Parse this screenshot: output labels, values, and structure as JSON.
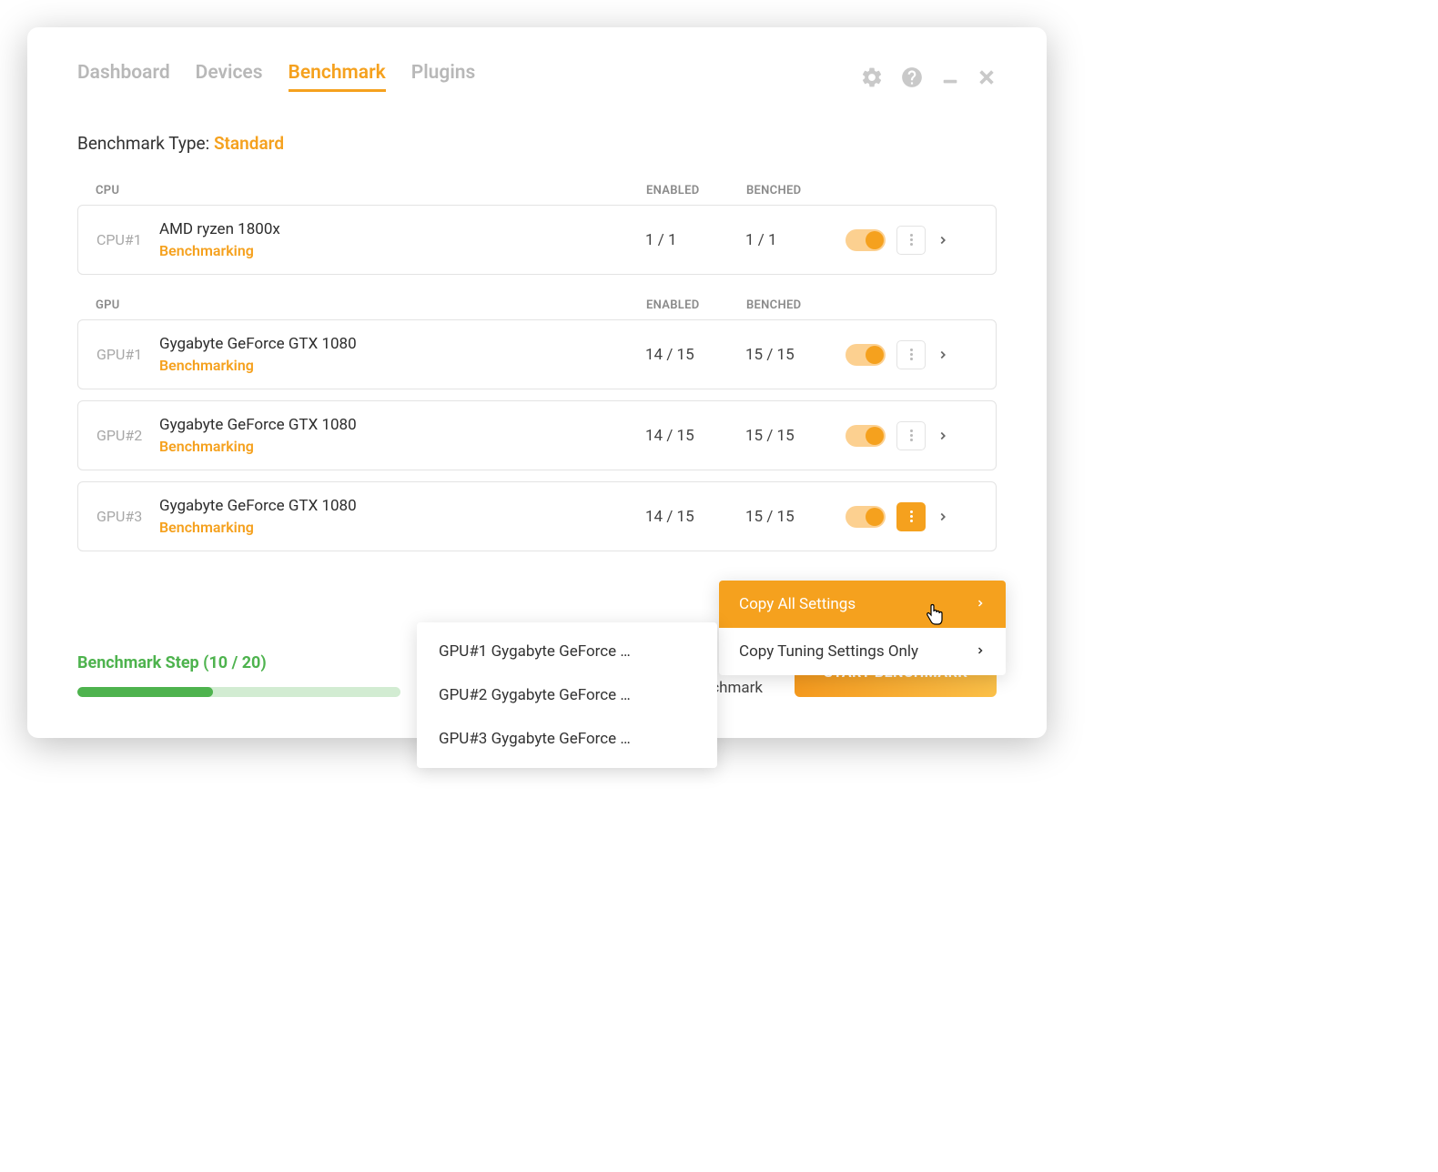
{
  "tabs": {
    "dashboard": "Dashboard",
    "devices": "Devices",
    "benchmark": "Benchmark",
    "plugins": "Plugins"
  },
  "bench_type_label": "Benchmark Type: ",
  "bench_type_value": "Standard",
  "cpu_section": {
    "title": "CPU",
    "col_enabled": "ENABLED",
    "col_benched": "BENCHED",
    "rows": [
      {
        "id": "CPU#1",
        "name": "AMD ryzen 1800x",
        "status": "Benchmarking",
        "enabled": "1 / 1",
        "benched": "1 / 1"
      }
    ]
  },
  "gpu_section": {
    "title": "GPU",
    "col_enabled": "ENABLED",
    "col_benched": "BENCHED",
    "rows": [
      {
        "id": "GPU#1",
        "name": "Gygabyte GeForce GTX 1080",
        "status": "Benchmarking",
        "enabled": "14 / 15",
        "benched": "15 / 15"
      },
      {
        "id": "GPU#2",
        "name": "Gygabyte GeForce GTX 1080",
        "status": "Benchmarking",
        "enabled": "14 / 15",
        "benched": "15 / 15"
      },
      {
        "id": "GPU#3",
        "name": "Gygabyte GeForce GTX 1080",
        "status": "Benchmarking",
        "enabled": "14 / 15",
        "benched": "15 / 15"
      }
    ]
  },
  "dropdown": {
    "copy_all": "Copy All Settings",
    "copy_tuning": "Copy Tuning Settings Only"
  },
  "submenu": {
    "item1": "GPU#1 Gygabyte GeForce …",
    "item2": "GPU#2 Gygabyte GeForce …",
    "item3": "GPU#3 Gygabyte GeForce …"
  },
  "progress": {
    "label": "Benchmark Step (10 / 20)",
    "percent": 42
  },
  "checkbox_label": "Start mining after benchmark",
  "start_button": "START BENCHMARK"
}
